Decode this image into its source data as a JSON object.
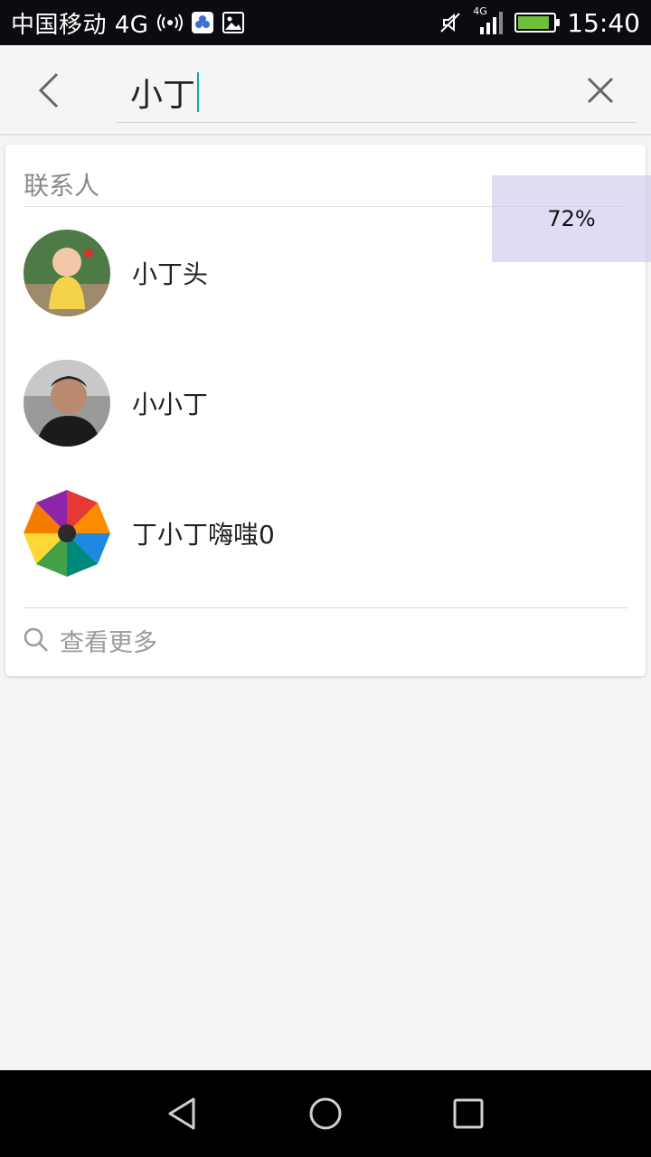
{
  "status_bar": {
    "carrier": "中国移动 4G",
    "network_small": "4G",
    "time": "15:40",
    "battery_level": 0.88
  },
  "search": {
    "query": "小丁"
  },
  "results": {
    "section_title": "联系人",
    "contacts": [
      {
        "name": "小丁头"
      },
      {
        "name": "小小丁"
      },
      {
        "name": "丁小丁嗨嗤0"
      }
    ],
    "more_label": "查看更多"
  },
  "overlay": {
    "percent": "72%"
  },
  "colors": {
    "accent_caret": "#16a3a8",
    "overlay_tint": "#ccc4ec",
    "battery_green": "#6ebf3a"
  }
}
